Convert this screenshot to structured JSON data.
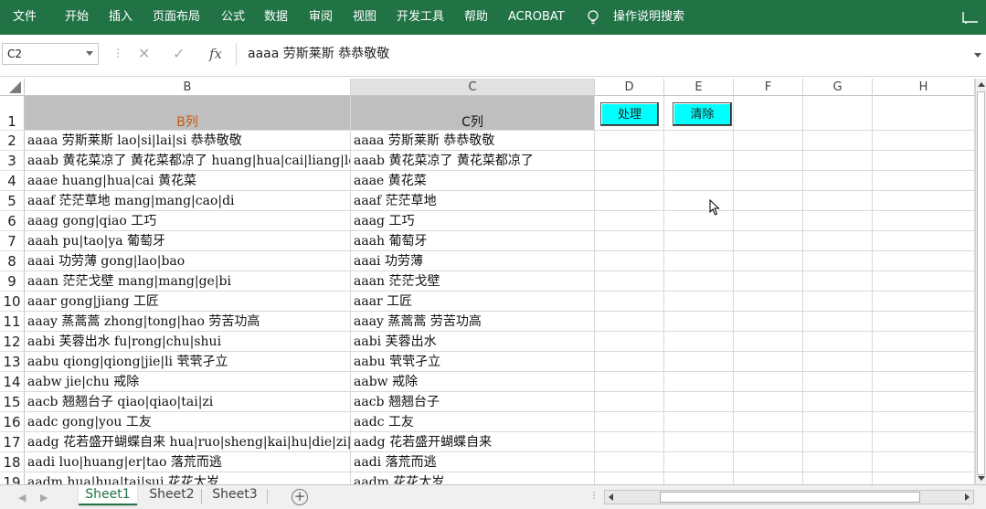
{
  "ribbon": {
    "tabs": [
      "文件",
      "开始",
      "插入",
      "页面布局",
      "公式",
      "数据",
      "审阅",
      "视图",
      "开发工具",
      "帮助",
      "ACROBAT"
    ],
    "tell_me": "操作说明搜索"
  },
  "formula_bar": {
    "name_box": "C2",
    "content": "aaaa 劳斯莱斯 恭恭敬敬"
  },
  "columns": [
    "B",
    "C",
    "D",
    "E",
    "F",
    "G",
    "H"
  ],
  "header_row": {
    "b1": "B列",
    "c1": "C列"
  },
  "buttons": {
    "process": "处理",
    "clear": "清除"
  },
  "rows": [
    {
      "n": "1"
    },
    {
      "n": "2",
      "b": "aaaa 劳斯莱斯 lao|si|lai|si 恭恭敬敬",
      "c": "aaaa 劳斯莱斯 恭恭敬敬"
    },
    {
      "n": "3",
      "b": "aaab 黄花菜凉了 黄花菜都凉了 huang|hua|cai|liang|le",
      "c": "aaab 黄花菜凉了 黄花菜都凉了"
    },
    {
      "n": "4",
      "b": "aaae huang|hua|cai 黄花菜",
      "c": "aaae 黄花菜"
    },
    {
      "n": "5",
      "b": "aaaf 茫茫草地 mang|mang|cao|di",
      "c": "aaaf 茫茫草地"
    },
    {
      "n": "6",
      "b": "aaag gong|qiao 工巧",
      "c": "aaag 工巧"
    },
    {
      "n": "7",
      "b": "aaah pu|tao|ya 葡萄牙",
      "c": "aaah 葡萄牙"
    },
    {
      "n": "8",
      "b": "aaai 功劳薄 gong|lao|bao",
      "c": "aaai 功劳薄"
    },
    {
      "n": "9",
      "b": "aaan 茫茫戈壁 mang|mang|ge|bi",
      "c": "aaan 茫茫戈壁"
    },
    {
      "n": "10",
      "b": "aaar gong|jiang 工匠",
      "c": "aaar 工匠"
    },
    {
      "n": "11",
      "b": "aaay 蒸蒿蒿 zhong|tong|hao 劳苦功高",
      "c": "aaay 蒸蒿蒿 劳苦功高"
    },
    {
      "n": "12",
      "b": "aabi 芙蓉出水 fu|rong|chu|shui",
      "c": "aabi 芙蓉出水"
    },
    {
      "n": "13",
      "b": "aabu qiong|qiong|jie|li 茕茕孑立",
      "c": "aabu 茕茕孑立"
    },
    {
      "n": "14",
      "b": "aabw jie|chu 戒除",
      "c": "aabw 戒除"
    },
    {
      "n": "15",
      "b": "aacb 翘翘台子 qiao|qiao|tai|zi",
      "c": "aacb 翘翘台子"
    },
    {
      "n": "16",
      "b": "aadc gong|you 工友",
      "c": "aadc 工友"
    },
    {
      "n": "17",
      "b": "aadg 花若盛开蝴蝶自来 hua|ruo|sheng|kai|hu|die|zi|lai",
      "c": "aadg 花若盛开蝴蝶自来"
    },
    {
      "n": "18",
      "b": "aadi luo|huang|er|tao 落荒而逃",
      "c": "aadi 落荒而逃"
    },
    {
      "n": "19",
      "b": "aadm hua|hua|tai|sui 花花太岁",
      "c": "aadm 花花太岁"
    }
  ],
  "sheets": [
    "Sheet1",
    "Sheet2",
    "Sheet3"
  ]
}
